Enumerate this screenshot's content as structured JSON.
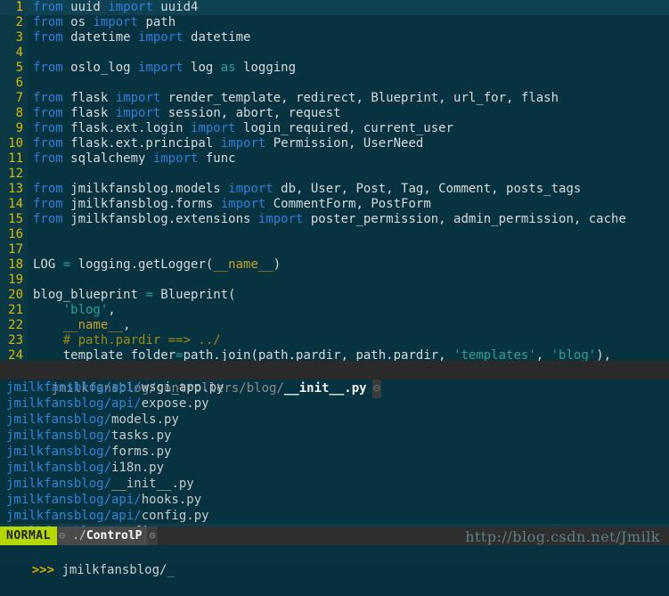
{
  "editor": {
    "filetype": "python",
    "cursor_line": 1,
    "lines": [
      {
        "n": "1",
        "tokens": [
          {
            "t": "from",
            "c": "kw"
          },
          {
            "t": " uuid ",
            "c": "plain"
          },
          {
            "t": "import",
            "c": "kw"
          },
          {
            "t": " uuid4",
            "c": "plain"
          }
        ]
      },
      {
        "n": "2",
        "tokens": [
          {
            "t": "from",
            "c": "kw"
          },
          {
            "t": " os ",
            "c": "plain"
          },
          {
            "t": "import",
            "c": "kw"
          },
          {
            "t": " path",
            "c": "plain"
          }
        ]
      },
      {
        "n": "3",
        "tokens": [
          {
            "t": "from",
            "c": "kw"
          },
          {
            "t": " datetime ",
            "c": "plain"
          },
          {
            "t": "import",
            "c": "kw"
          },
          {
            "t": " datetime",
            "c": "plain"
          }
        ]
      },
      {
        "n": "4",
        "tokens": []
      },
      {
        "n": "5",
        "tokens": [
          {
            "t": "from",
            "c": "kw"
          },
          {
            "t": " oslo_log ",
            "c": "plain"
          },
          {
            "t": "import",
            "c": "kw"
          },
          {
            "t": " log ",
            "c": "plain"
          },
          {
            "t": "as",
            "c": "asop"
          },
          {
            "t": " logging",
            "c": "plain"
          }
        ]
      },
      {
        "n": "6",
        "tokens": []
      },
      {
        "n": "7",
        "tokens": [
          {
            "t": "from",
            "c": "kw"
          },
          {
            "t": " flask ",
            "c": "plain"
          },
          {
            "t": "import",
            "c": "kw"
          },
          {
            "t": " render_template, redirect, Blueprint, url_for, flash",
            "c": "plain"
          }
        ]
      },
      {
        "n": "8",
        "tokens": [
          {
            "t": "from",
            "c": "kw"
          },
          {
            "t": " flask ",
            "c": "plain"
          },
          {
            "t": "import",
            "c": "kw"
          },
          {
            "t": " session, abort, request",
            "c": "plain"
          }
        ]
      },
      {
        "n": "9",
        "tokens": [
          {
            "t": "from",
            "c": "kw"
          },
          {
            "t": " flask.ext.login ",
            "c": "plain"
          },
          {
            "t": "import",
            "c": "kw"
          },
          {
            "t": " login_required, current_user",
            "c": "plain"
          }
        ]
      },
      {
        "n": "10",
        "tokens": [
          {
            "t": "from",
            "c": "kw"
          },
          {
            "t": " flask.ext.principal ",
            "c": "plain"
          },
          {
            "t": "import",
            "c": "kw"
          },
          {
            "t": " Permission, UserNeed",
            "c": "plain"
          }
        ]
      },
      {
        "n": "11",
        "tokens": [
          {
            "t": "from",
            "c": "kw"
          },
          {
            "t": " sqlalchemy ",
            "c": "plain"
          },
          {
            "t": "import",
            "c": "kw"
          },
          {
            "t": " func",
            "c": "plain"
          }
        ]
      },
      {
        "n": "12",
        "tokens": []
      },
      {
        "n": "13",
        "tokens": [
          {
            "t": "from",
            "c": "kw"
          },
          {
            "t": " jmilkfansblog.models ",
            "c": "plain"
          },
          {
            "t": "import",
            "c": "kw"
          },
          {
            "t": " db, User, Post, Tag, Comment, posts_tags",
            "c": "plain"
          }
        ]
      },
      {
        "n": "14",
        "tokens": [
          {
            "t": "from",
            "c": "kw"
          },
          {
            "t": " jmilkfansblog.forms ",
            "c": "plain"
          },
          {
            "t": "import",
            "c": "kw"
          },
          {
            "t": " CommentForm, PostForm",
            "c": "plain"
          }
        ]
      },
      {
        "n": "15",
        "tokens": [
          {
            "t": "from",
            "c": "kw"
          },
          {
            "t": " jmilkfansblog.extensions ",
            "c": "plain"
          },
          {
            "t": "import",
            "c": "kw"
          },
          {
            "t": " poster_permission, admin_permission, cache",
            "c": "plain"
          }
        ]
      },
      {
        "n": "16",
        "tokens": []
      },
      {
        "n": "17",
        "tokens": []
      },
      {
        "n": "18",
        "tokens": [
          {
            "t": "LOG ",
            "c": "plain"
          },
          {
            "t": "=",
            "c": "op"
          },
          {
            "t": " logging.getLogger(",
            "c": "plain"
          },
          {
            "t": "__name__",
            "c": "dund"
          },
          {
            "t": ")",
            "c": "plain"
          }
        ]
      },
      {
        "n": "19",
        "tokens": []
      },
      {
        "n": "20",
        "tokens": [
          {
            "t": "blog_blueprint ",
            "c": "plain"
          },
          {
            "t": "=",
            "c": "op"
          },
          {
            "t": " Blueprint(",
            "c": "plain"
          }
        ]
      },
      {
        "n": "21",
        "tokens": [
          {
            "t": "    ",
            "c": "plain"
          },
          {
            "t": "'blog'",
            "c": "str"
          },
          {
            "t": ",",
            "c": "plain"
          }
        ]
      },
      {
        "n": "22",
        "tokens": [
          {
            "t": "    ",
            "c": "plain"
          },
          {
            "t": "__name__",
            "c": "dund"
          },
          {
            "t": ",",
            "c": "plain"
          }
        ]
      },
      {
        "n": "23",
        "tokens": [
          {
            "t": "    ",
            "c": "plain"
          },
          {
            "t": "# path.pardir ==> ../",
            "c": "cmt"
          }
        ]
      },
      {
        "n": "24",
        "tokens": [
          {
            "t": "    template_folder",
            "c": "plain"
          },
          {
            "t": "=",
            "c": "op"
          },
          {
            "t": "path.join(path.pardir, path.pardir, ",
            "c": "plain"
          },
          {
            "t": "'templates'",
            "c": "str"
          },
          {
            "t": ", ",
            "c": "plain"
          },
          {
            "t": "'blog'",
            "c": "str"
          },
          {
            "t": "),",
            "c": "plain"
          }
        ]
      }
    ]
  },
  "filepane": {
    "current_path_prefix": "jmilkfansblog/controllers/blog/",
    "current_file": "__init__.py",
    "path_glyph": "⊖",
    "files": [
      {
        "dir": "jmilkfansblog/api/",
        "name": "wsgi_app.py",
        "selected": false
      },
      {
        "dir": "jmilkfansblog/api/",
        "name": "expose.py",
        "selected": false
      },
      {
        "dir": "jmilkfansblog/",
        "name": "models.py",
        "selected": false
      },
      {
        "dir": "jmilkfansblog/",
        "name": "tasks.py",
        "selected": false
      },
      {
        "dir": "jmilkfansblog/",
        "name": "forms.py",
        "selected": false
      },
      {
        "dir": "jmilkfansblog/",
        "name": "i18n.py",
        "selected": false
      },
      {
        "dir": "jmilkfansblog/",
        "name": "__init__.py",
        "selected": false
      },
      {
        "dir": "jmilkfansblog/api/",
        "name": "hooks.py",
        "selected": false
      },
      {
        "dir": "jmilkfansblog/api/",
        "name": "config.py",
        "selected": false
      },
      {
        "dir": "jmilkfansblog/",
        "name": "config.py",
        "selected": true
      }
    ],
    "selected_marker": ">"
  },
  "statusline": {
    "mode": "NORMAL",
    "left_glyph": "⊖",
    "path_dim": "./",
    "path_bold": "ControlP",
    "right_glyph": "⊖",
    "watermark": "http://blog.csdn.net/Jmilk"
  },
  "prompt": {
    "chevron": ">>>",
    "text": " jmilkfansblog/",
    "cursor": "_"
  },
  "colors": {
    "background": "#07323f",
    "gutter": "#0b3845",
    "cursorline": "#0e4152",
    "keyword": "#2f7fd8",
    "string": "#2aa198",
    "comment": "#9c8a16",
    "linenumber": "#d8b800",
    "mode_badge": "#b5d800",
    "statusbar": "#2e2e2e",
    "dir_blue": "#2e86d8"
  }
}
